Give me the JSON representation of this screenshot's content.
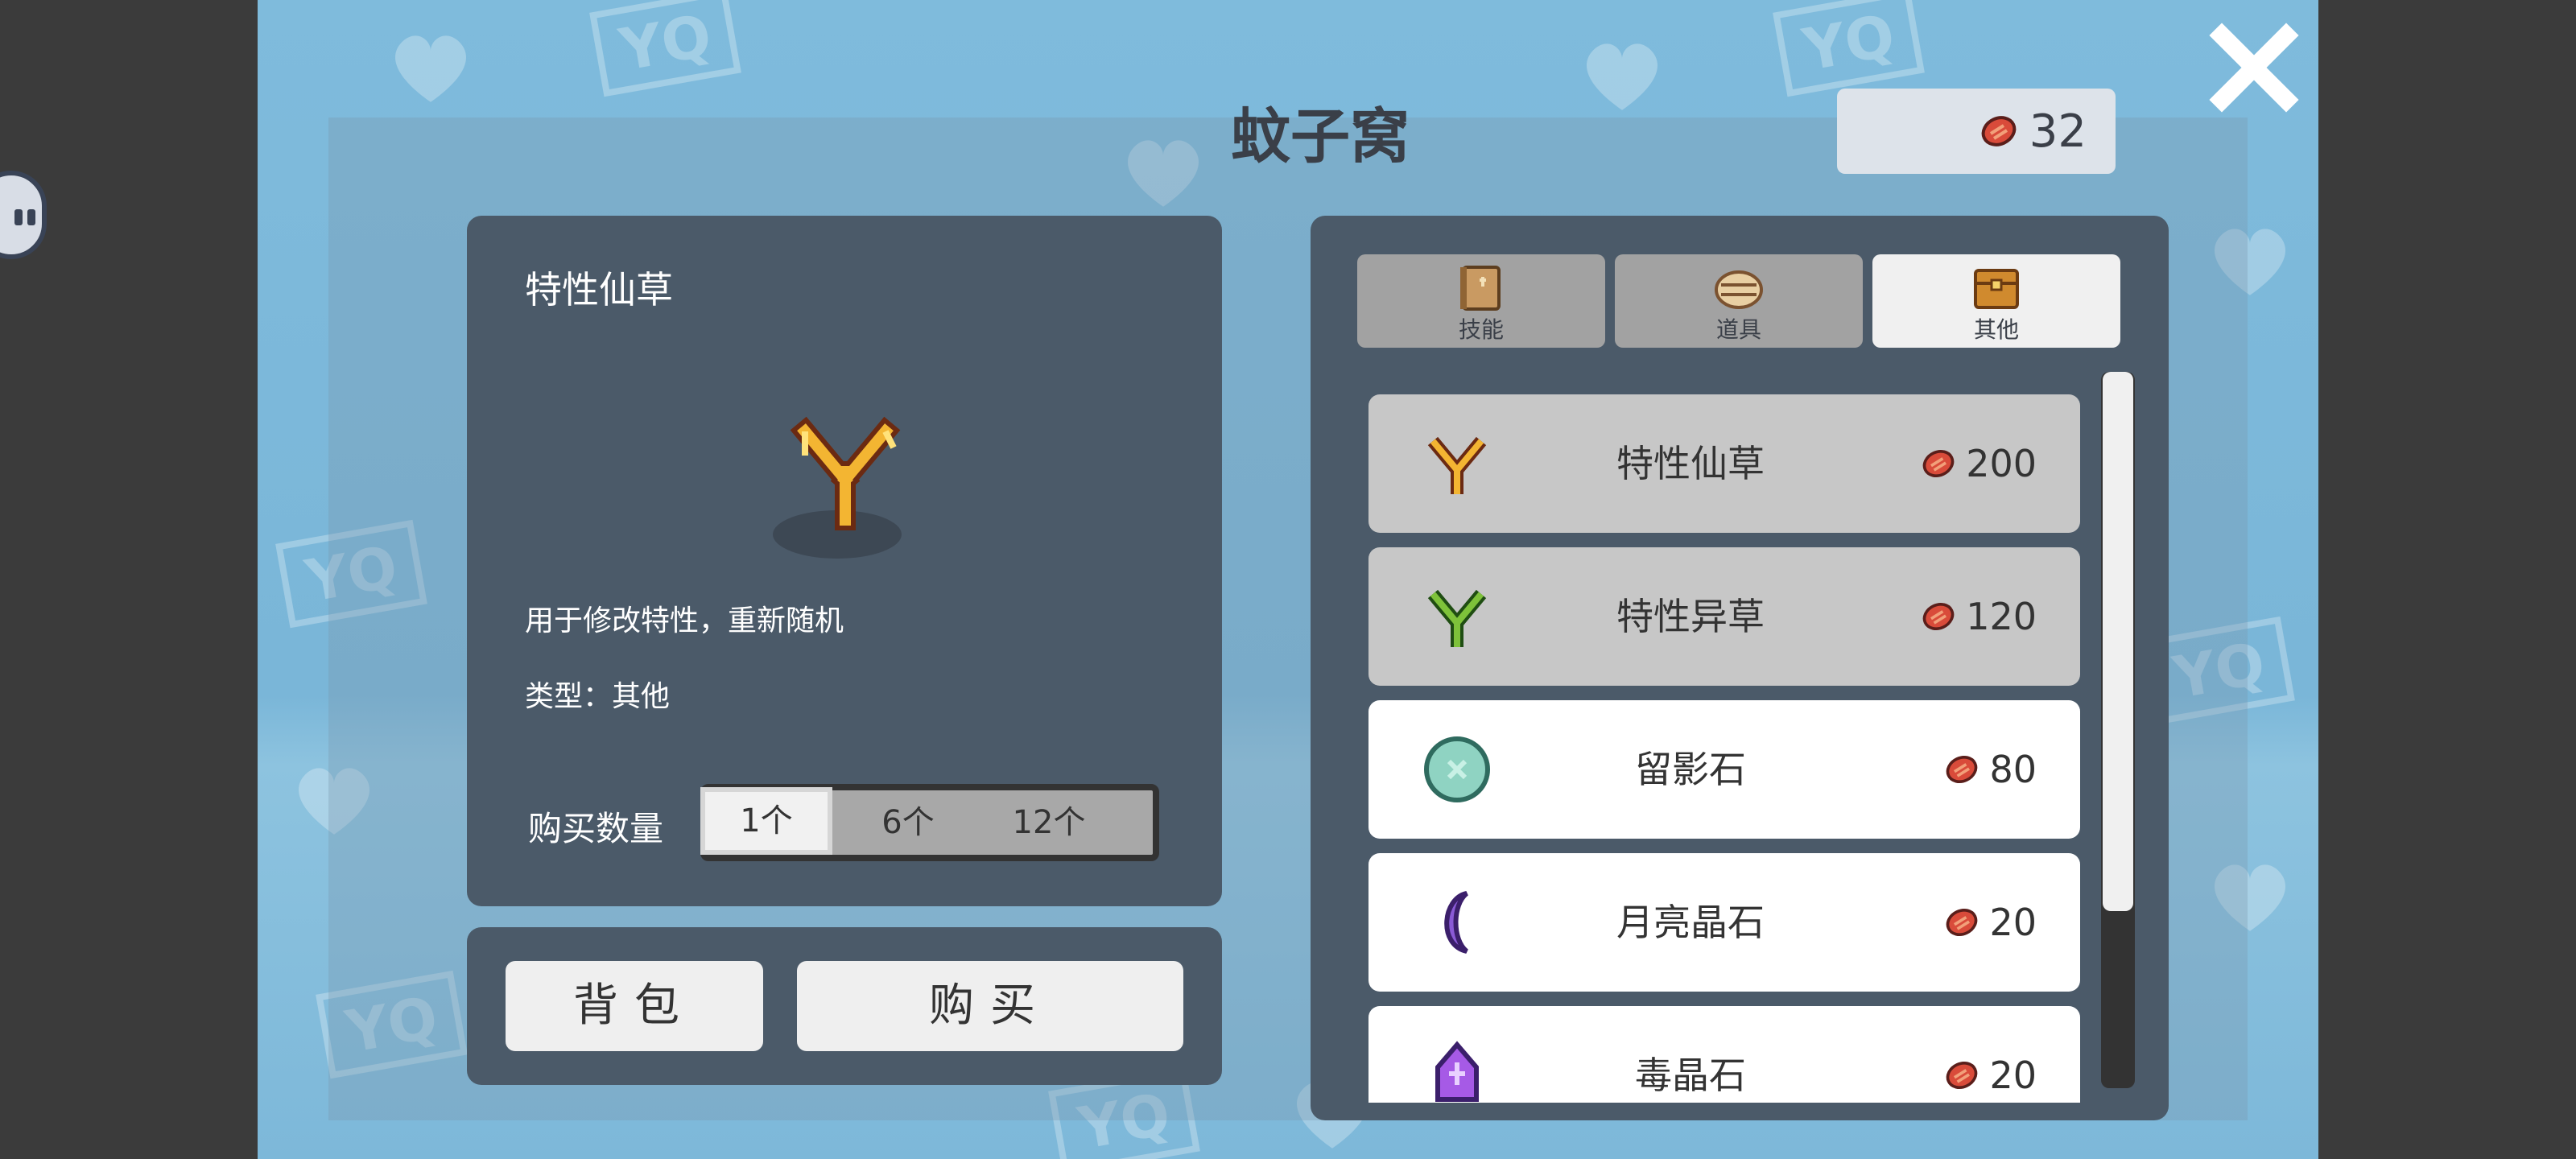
{
  "shop": {
    "title": "蚊子窝",
    "currency_amount": "32"
  },
  "detail": {
    "item_name": "特性仙草",
    "description": "用于修改特性，重新随机",
    "type_line": "类型：其他",
    "quantity_label": "购买数量",
    "quantity_options": [
      "1个",
      "6个",
      "12个"
    ],
    "selected_quantity": "1个"
  },
  "actions": {
    "bag_label": "背包",
    "buy_label": "购买"
  },
  "tabs": [
    {
      "label": "技能",
      "active": false,
      "icon": "skill-book-icon"
    },
    {
      "label": "道具",
      "active": false,
      "icon": "item-pot-icon"
    },
    {
      "label": "其他",
      "active": true,
      "icon": "chest-icon"
    }
  ],
  "items": [
    {
      "name": "特性仙草",
      "price": "200",
      "icon": "golden-herb-icon",
      "state": "owned"
    },
    {
      "name": "特性异草",
      "price": "120",
      "icon": "green-herb-icon",
      "state": "owned"
    },
    {
      "name": "留影石",
      "price": "80",
      "icon": "shadow-stone-icon",
      "state": "available"
    },
    {
      "name": "月亮晶石",
      "price": "20",
      "icon": "moon-crystal-icon",
      "state": "available"
    },
    {
      "name": "毒晶石",
      "price": "20",
      "icon": "poison-crystal-icon",
      "state": "available"
    }
  ],
  "colors": {
    "background_blue": "#7fbbdc",
    "panel": "#4b5a69",
    "owned_row": "#c7c7c7",
    "coin": "#d94b3a"
  }
}
